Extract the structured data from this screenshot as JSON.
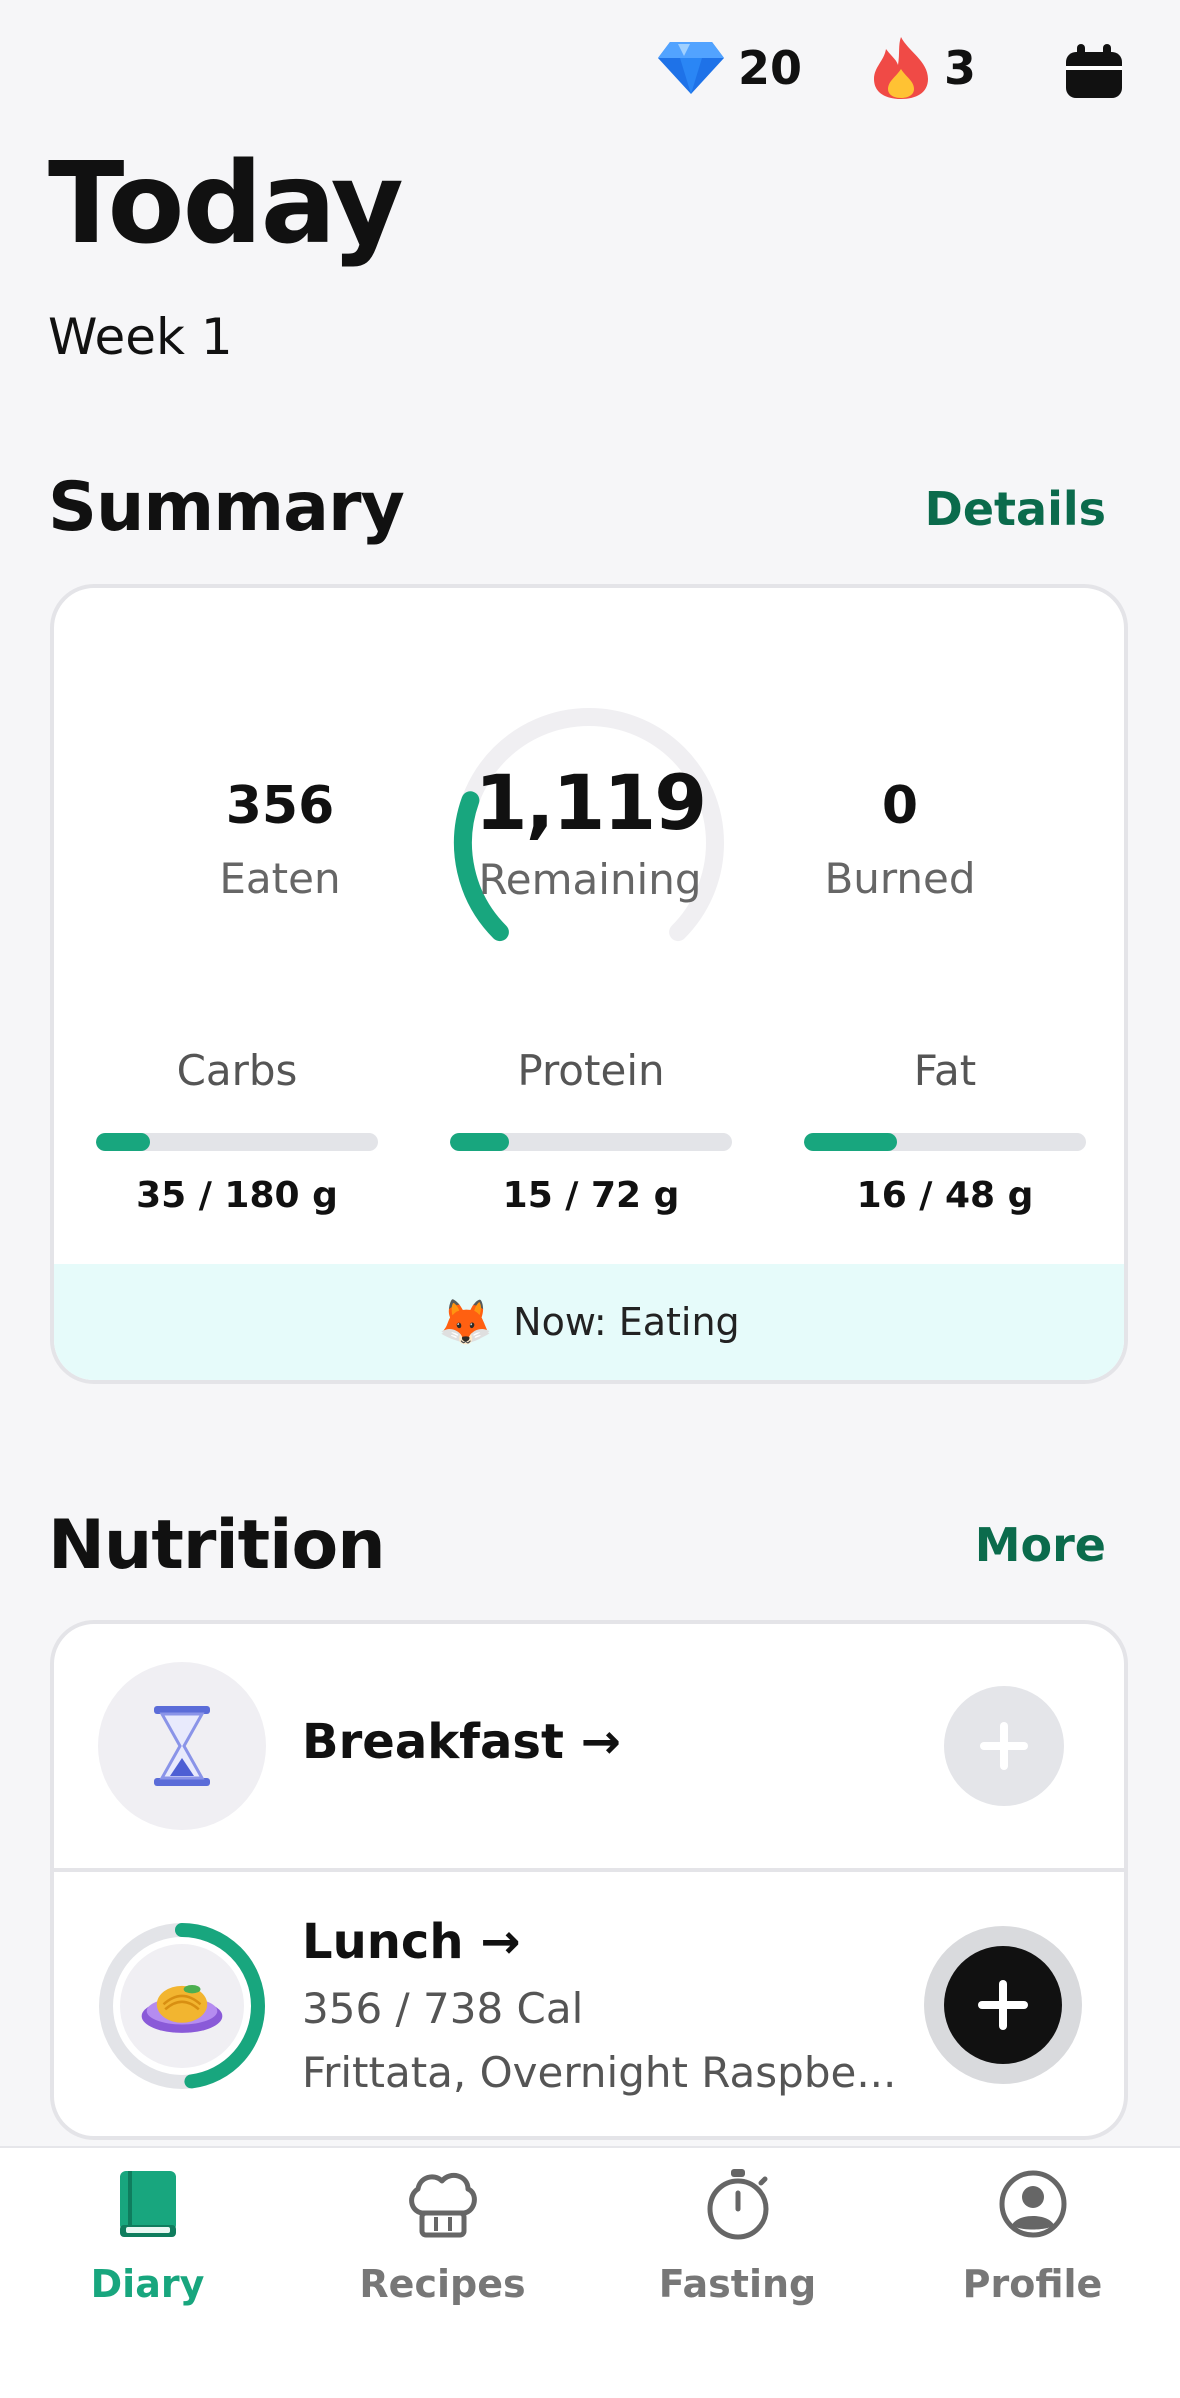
{
  "topbar": {
    "gems_count": "20",
    "streak_count": "3",
    "icons": [
      "gem-icon",
      "flame-icon",
      "calendar-icon"
    ]
  },
  "header": {
    "title": "Today",
    "week": "Week 1"
  },
  "summary": {
    "title": "Summary",
    "link": "Details",
    "eaten_value": "356",
    "eaten_label": "Eaten",
    "remaining_value": "1,119",
    "remaining_label": "Remaining",
    "burned_value": "0",
    "burned_label": "Burned",
    "ring_progress": 0.24,
    "macros": [
      {
        "name": "Carbs",
        "value": "35 / 180 g",
        "progress": 0.19
      },
      {
        "name": "Protein",
        "value": "15 / 72 g",
        "progress": 0.21
      },
      {
        "name": "Fat",
        "value": "16 / 48 g",
        "progress": 0.33
      }
    ],
    "status": "Now: Eating"
  },
  "nutrition": {
    "title": "Nutrition",
    "link": "More",
    "meals": [
      {
        "name": "Breakfast →",
        "icon": "hourglass-icon"
      },
      {
        "name": "Lunch →",
        "calories": "356 / 738 Cal",
        "items": "Frittata, Overnight Raspbe...",
        "icon": "pasta-icon",
        "progress": 0.48
      }
    ]
  },
  "nav": {
    "items": [
      {
        "label": "Diary",
        "icon": "book-icon",
        "active": true
      },
      {
        "label": "Recipes",
        "icon": "chef-hat-icon"
      },
      {
        "label": "Fasting",
        "icon": "stopwatch-icon"
      },
      {
        "label": "Profile",
        "icon": "user-icon"
      }
    ]
  },
  "colors": {
    "accent": "#18a67e",
    "link": "#0b6b4c",
    "banner": "#e6fbfa"
  }
}
